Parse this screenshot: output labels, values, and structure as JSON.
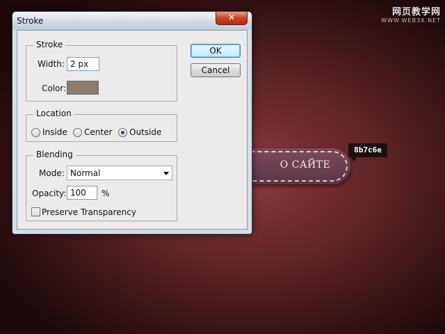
{
  "watermark": {
    "main": "网页教学网",
    "sub": "WWW.WEB3X.NET"
  },
  "canvas": {
    "button_text": "О САЙТЕ",
    "tooltip": "8b7c6e"
  },
  "dialog": {
    "title": "Stroke",
    "close_glyph": "✕",
    "stroke": {
      "group_label": "Stroke",
      "width_label": "Width:",
      "width_value": "2 px",
      "color_label": "Color:",
      "color_value": "#8b7c6e"
    },
    "location": {
      "group_label": "Location",
      "inside": "Inside",
      "center": "Center",
      "outside": "Outside",
      "selected": "Outside"
    },
    "blending": {
      "group_label": "Blending",
      "mode_label": "Mode:",
      "mode_value": "Normal",
      "opacity_label": "Opacity:",
      "opacity_value": "100",
      "opacity_unit": "%",
      "preserve_label": "Preserve Transparency",
      "preserve_checked": false
    },
    "buttons": {
      "ok": "OK",
      "cancel": "Cancel"
    }
  },
  "colors": {
    "stroke_color": "#8b7c6e",
    "canvas_button": "#6b3e51",
    "background": "#5e2427"
  }
}
